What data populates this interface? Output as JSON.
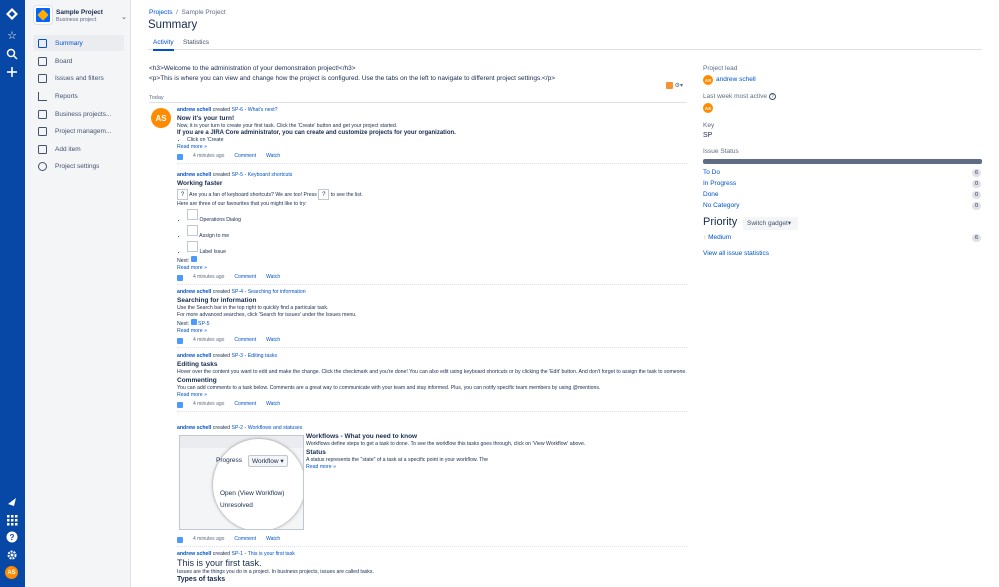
{
  "nav": {
    "avatar": "AS"
  },
  "project": {
    "name": "Sample Project",
    "type": "Business project"
  },
  "sidebar": {
    "items": [
      {
        "label": "Summary"
      },
      {
        "label": "Board"
      },
      {
        "label": "Issues and filters"
      },
      {
        "label": "Reports"
      },
      {
        "label": "Business projects..."
      },
      {
        "label": "Project managem..."
      },
      {
        "label": "Add item"
      },
      {
        "label": "Project settings"
      }
    ]
  },
  "breadcrumbs": {
    "root": "Projects",
    "sep": "/",
    "current": "Sample Project"
  },
  "page": {
    "title": "Summary"
  },
  "tabs": [
    {
      "label": "Activity"
    },
    {
      "label": "Statistics"
    }
  ],
  "intro": {
    "line1": "<h3>Welcome to the administration of your demonstration project!</h3>",
    "line2": "<p>This is where you can view and change how the project is configured. Use the tabs on the left to navigate to different project settings.</p>"
  },
  "feed": {
    "settings_icon": "gear-icon",
    "today": "Today",
    "avatar": "AS"
  },
  "entries": [
    {
      "user": "andrew schell",
      "verb": "created",
      "key": "SP-6",
      "summary": "What's next?",
      "title": "Now it's your turn!",
      "line1": "Now, it is your turn to create your first task. Click the 'Create' button and get your project started.",
      "line2": "If you are a JIRA Core administrator, you can create and customize projects for your organization.",
      "bullet": "Click on 'Create",
      "readmore": "Read more »",
      "time": "4 minutes ago",
      "comment": "Comment",
      "watch": "Watch"
    },
    {
      "user": "andrew schell",
      "verb": "created",
      "key": "SP-5",
      "summary": "Keyboard shortcuts",
      "title": "Working faster",
      "key1": "?",
      "line1": "Are you a fan of keyboard shortcuts? We are too! Press",
      "key2": "?",
      "line1b": "to see the list.",
      "line2": "Here are three of our favourites that you might like to try:",
      "b1": "Operations Dialog",
      "b2": "Assign to me",
      "b3": "Label Issue",
      "next": "Next:",
      "readmore": "Read more »",
      "time": "4 minutes ago",
      "comment": "Comment",
      "watch": "Watch"
    },
    {
      "user": "andrew schell",
      "verb": "created",
      "key": "SP-4",
      "summary": "Searching for information",
      "title": "Searching for information",
      "line1": "Use the Search bar in the top right to quickly find a particular task.",
      "line2": "For more advanced searches, click 'Search for issues' under the Issues menu.",
      "next": "Next:",
      "next_key": "SP-5",
      "readmore": "Read more »",
      "time": "4 minutes ago",
      "comment": "Comment",
      "watch": "Watch"
    },
    {
      "user": "andrew schell",
      "verb": "created",
      "key": "SP-3",
      "summary": "Editing tasks",
      "title": "Editing tasks",
      "line1": "Hover over the content you want to edit and make the change. Click the checkmark and you're done! You can also edit using keyboard shortcuts or by clicking the 'Edit' button. And don't forget to assign the task to someone.",
      "title2": "Commenting",
      "line2": "You can add comments to a task below. Comments are a great way to communicate with your team and stay informed. Plus, you can notify specific team members by using @mentions.",
      "readmore": "Read more »",
      "time": "4 minutes ago",
      "comment": "Comment",
      "watch": "Watch"
    },
    {
      "user": "andrew schell",
      "verb": "created",
      "key": "SP-2",
      "summary": "Workflows and statuses",
      "title": "Workflows - What you need to know",
      "line1": "Workflows define steps to get a task to done. To see the workflow this tasks goes through, click on 'View Workflow' above.",
      "title2": "Status",
      "line2": "A status represents the \"state\" of a task at a specific point in your workflow. The",
      "img_progress": "Progress",
      "img_workflow": "Workflow",
      "img_open": "Open (View Workflow)",
      "img_unresolved": "Unresolved",
      "readmore": "Read more »",
      "time": "4 minutes ago",
      "comment": "Comment",
      "watch": "Watch"
    },
    {
      "user": "andrew schell",
      "verb": "created",
      "key": "SP-1",
      "summary": "This is your first task",
      "title": "This is your first task.",
      "line1": "Issues are the things you do in a project. In business projects, issues are called tasks.",
      "title2": "Types of tasks"
    }
  ],
  "right": {
    "lead_label": "Project lead",
    "lead_avatar": "AS",
    "lead_name": "andrew schell",
    "active_label": "Last week most active",
    "active_avatar": "AS",
    "key_label": "Key",
    "key_value": "SP",
    "status_label": "Issue Status",
    "statuses": [
      {
        "name": "To Do",
        "count": "6"
      },
      {
        "name": "In Progress",
        "count": "0"
      },
      {
        "name": "Done",
        "count": "0"
      },
      {
        "name": "No Category",
        "count": "0"
      }
    ],
    "priority_title": "Priority",
    "switch_gadget": "Switch gadget",
    "priority_item": "Medium",
    "priority_count": "6",
    "view_all": "View all issue statistics"
  },
  "colors": {
    "nav": "#0747a6",
    "link": "#0052cc",
    "avatar": "#ff8b00",
    "status_bar": "#5e6c84"
  }
}
